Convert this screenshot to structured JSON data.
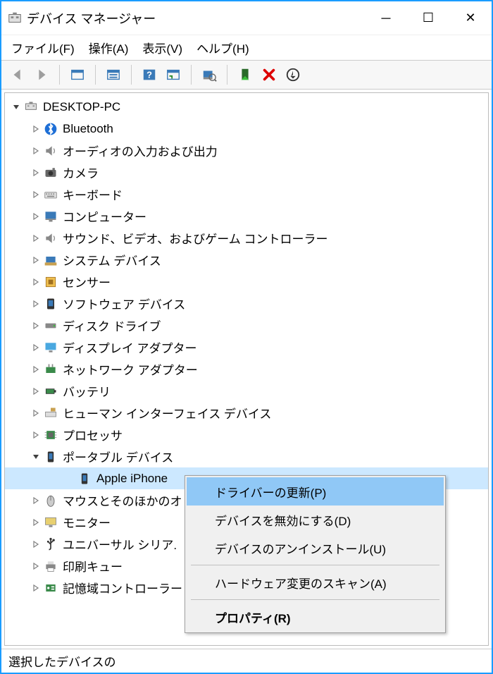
{
  "title": "デバイス マネージャー",
  "win": {
    "min": "－",
    "max": "☐",
    "close": "✕"
  },
  "menu": {
    "file": "ファイル(F)",
    "action": "操作(A)",
    "view": "表示(V)",
    "help": "ヘルプ(H)"
  },
  "root": "DESKTOP-PC",
  "devices": [
    {
      "label": "Bluetooth",
      "icon": "bluetooth"
    },
    {
      "label": "オーディオの入力および出力",
      "icon": "speaker"
    },
    {
      "label": "カメラ",
      "icon": "camera"
    },
    {
      "label": "キーボード",
      "icon": "keyboard"
    },
    {
      "label": "コンピューター",
      "icon": "monitor"
    },
    {
      "label": "サウンド、ビデオ、およびゲーム コントローラー",
      "icon": "speaker"
    },
    {
      "label": "システム デバイス",
      "icon": "system"
    },
    {
      "label": "センサー",
      "icon": "sensor"
    },
    {
      "label": "ソフトウェア デバイス",
      "icon": "software"
    },
    {
      "label": "ディスク ドライブ",
      "icon": "disk"
    },
    {
      "label": "ディスプレイ アダプター",
      "icon": "display"
    },
    {
      "label": "ネットワーク アダプター",
      "icon": "network"
    },
    {
      "label": "バッテリ",
      "icon": "battery"
    },
    {
      "label": "ヒューマン インターフェイス デバイス",
      "icon": "hid"
    },
    {
      "label": "プロセッサ",
      "icon": "cpu"
    },
    {
      "label": "ポータブル デバイス",
      "icon": "portable",
      "expanded": true,
      "children": [
        {
          "label": "Apple iPhone",
          "icon": "portable",
          "selected": true
        }
      ]
    },
    {
      "label": "マウスとそのほかのオ",
      "icon": "mouse"
    },
    {
      "label": "モニター",
      "icon": "monitor-dev"
    },
    {
      "label": "ユニバーサル シリア.",
      "icon": "usb"
    },
    {
      "label": "印刷キュー",
      "icon": "printer"
    },
    {
      "label": "記憶域コントローラー",
      "icon": "storage"
    }
  ],
  "context": {
    "update": "ドライバーの更新(P)",
    "disable": "デバイスを無効にする(D)",
    "uninstall": "デバイスのアンインストール(U)",
    "scan": "ハードウェア変更のスキャン(A)",
    "properties": "プロパティ(R)"
  },
  "status": "選択したデバイスの"
}
